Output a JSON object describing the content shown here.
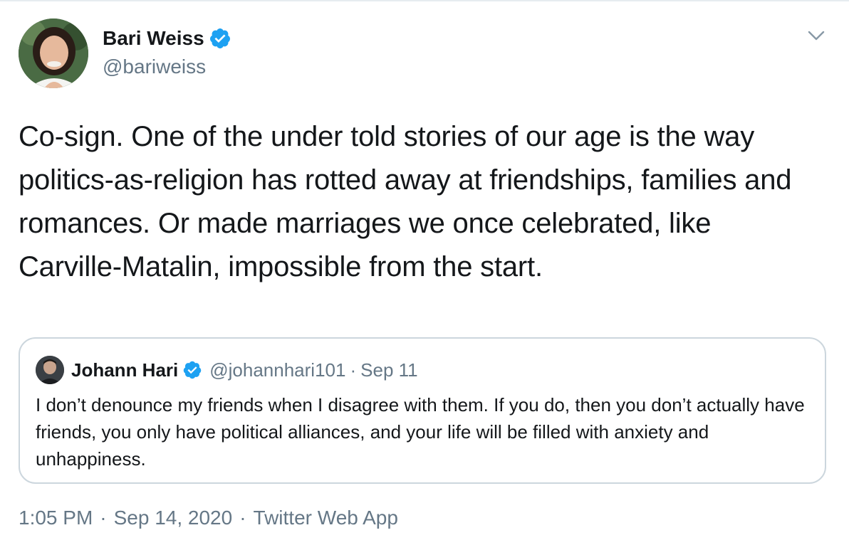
{
  "tweet": {
    "author": {
      "name": "Bari Weiss",
      "handle": "@bariweiss",
      "verified": true,
      "avatar": "profile-photo"
    },
    "menu_icon": "chevron-down-icon",
    "text": "Co-sign. One of the under told stories of our age is the way politics-as-religion has rotted away at friendships, families and romances. Or made marriages we once celebrated, like Carville-Matalin, impossible from the start.",
    "quote": {
      "author_name": "Johann Hari",
      "verified": true,
      "handle": "@johannhari101",
      "separator": "·",
      "date": "Sep 11",
      "text": "I don’t denounce my friends when I disagree with them. If you do, then you don’t actually have friends, you only have political alliances, and your life will be filled with anxiety and unhappiness."
    },
    "meta": {
      "time": "1:05 PM",
      "separator": "·",
      "date": "Sep 14, 2020",
      "source": "Twitter Web App"
    }
  },
  "colors": {
    "text": "#14171a",
    "secondary": "#657786",
    "border": "#ccd6dd",
    "verified": "#1da1f2"
  }
}
